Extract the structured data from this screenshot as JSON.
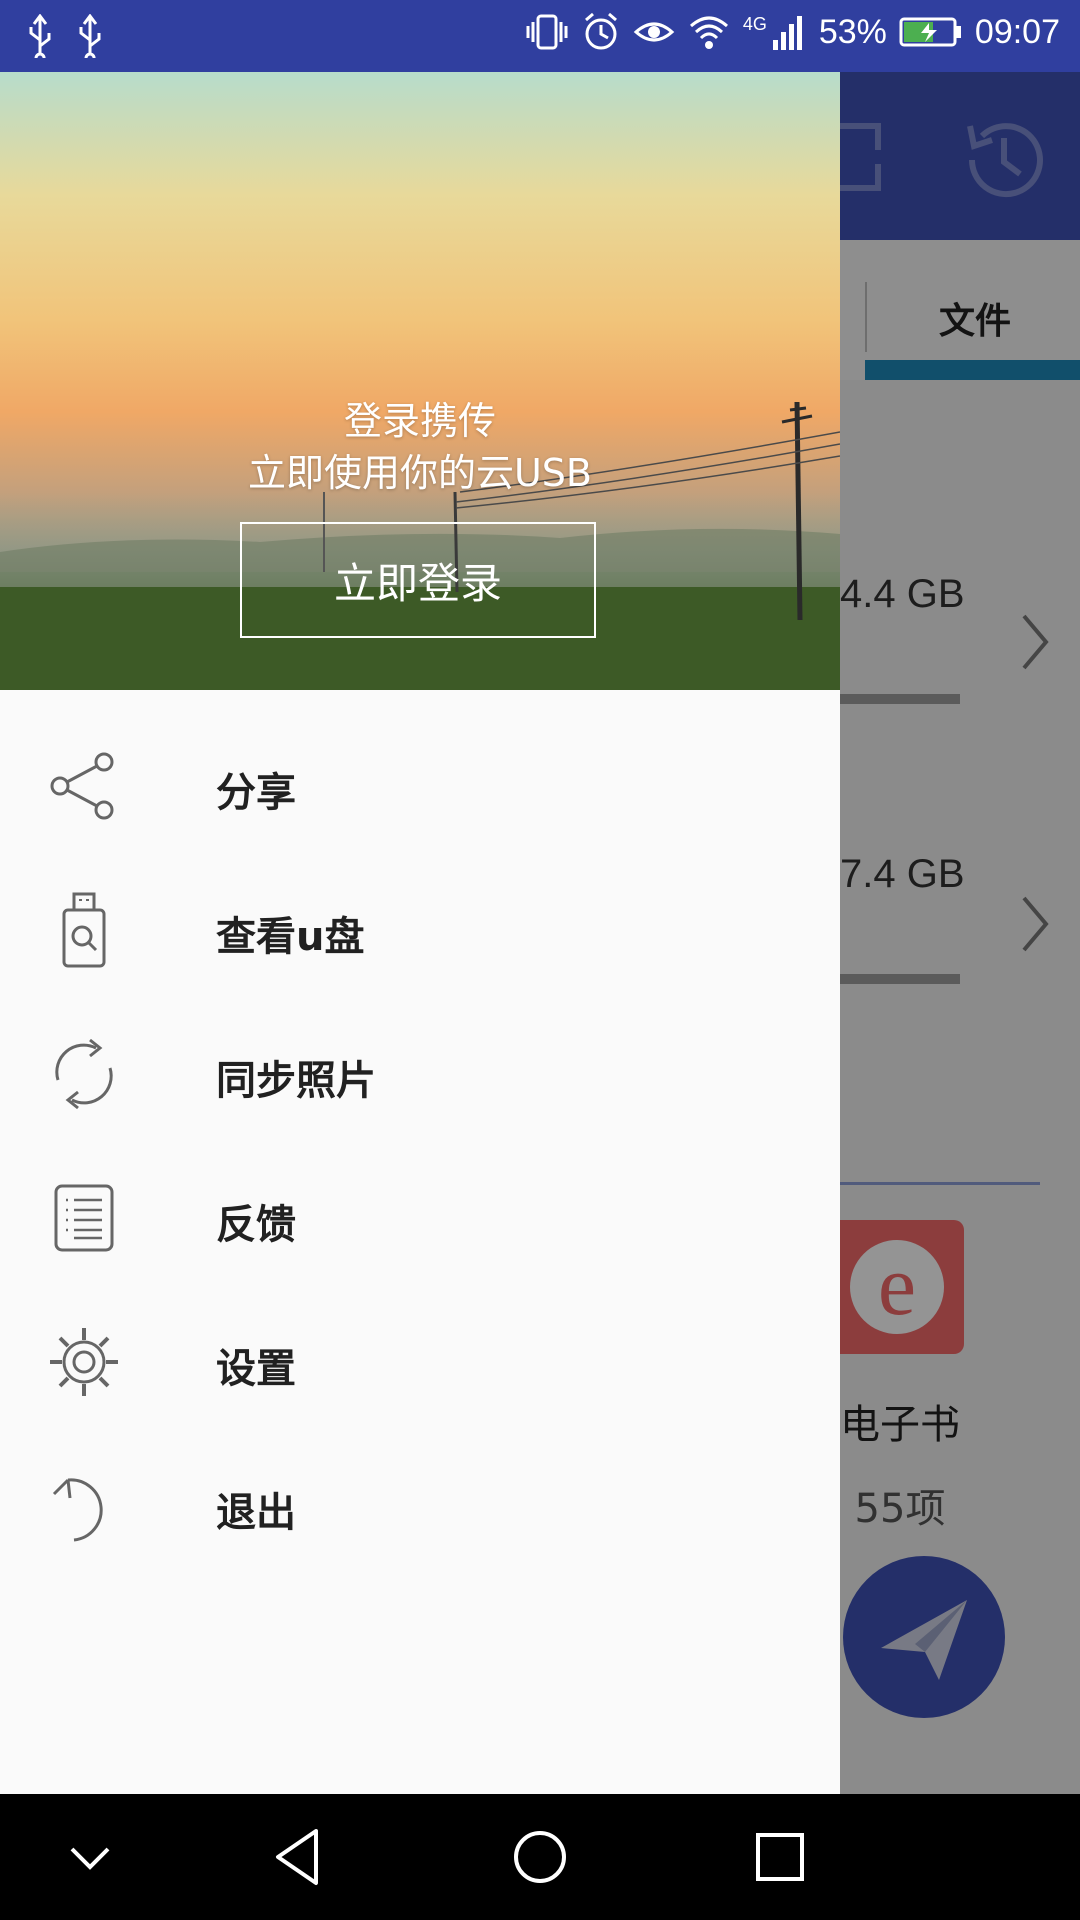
{
  "status_bar": {
    "battery_percent": "53%",
    "time": "09:07",
    "network": "4G",
    "background_color": "#303f9f"
  },
  "background_app": {
    "tab_files_label": "文件",
    "storage_items": [
      {
        "size": "4.4 GB"
      },
      {
        "size": "7.4 GB"
      }
    ],
    "ebook_label": "电子书",
    "ebook_count": "55项",
    "toolbar_color": "#3f51b5"
  },
  "drawer": {
    "header": {
      "line1": "登录携传",
      "line2": "立即使用你的云USB",
      "login_button": "立即登录"
    },
    "menu": [
      {
        "label": "分享",
        "icon": "share-icon"
      },
      {
        "label": "查看u盘",
        "icon": "usb-search-icon"
      },
      {
        "label": "同步照片",
        "icon": "sync-icon"
      },
      {
        "label": "反馈",
        "icon": "feedback-list-icon"
      },
      {
        "label": "设置",
        "icon": "gear-icon"
      },
      {
        "label": "退出",
        "icon": "exit-icon"
      }
    ]
  },
  "nav_bar": {
    "buttons": [
      "chevron-down-icon",
      "back-icon",
      "home-icon",
      "recents-icon"
    ]
  }
}
